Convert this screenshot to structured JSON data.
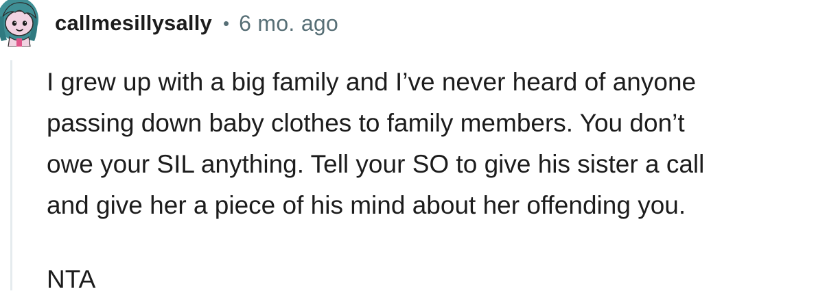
{
  "comment": {
    "avatar_icon": "snoo-avatar-icon",
    "username": "callmesillysally",
    "separator": "•",
    "timestamp": "6 mo. ago",
    "body_lines": [
      "I grew up with a big family and I’ve never heard of anyone",
      "passing down baby clothes to family members. You don’t",
      "owe your SIL anything. Tell your SO to give his sister a call",
      "and give her a piece of his mind about her offending you."
    ],
    "verdict": "NTA"
  },
  "colors": {
    "text": "#1c1c1c",
    "meta": "#576f76",
    "thread_line": "#e5ebee",
    "avatar_hair": "#3f8f95",
    "avatar_skin": "#f2d3e2"
  }
}
